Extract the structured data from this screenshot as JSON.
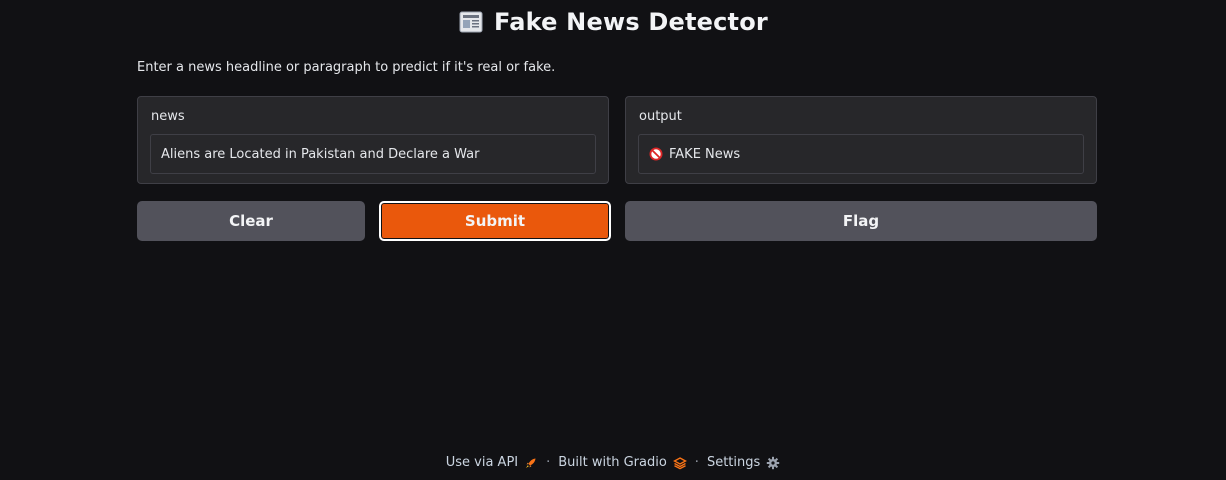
{
  "app": {
    "title": "Fake News Detector",
    "title_icon": "newspaper-icon",
    "description": "Enter a news headline or paragraph to predict if it's real or fake."
  },
  "input_panel": {
    "label": "news",
    "value": "Aliens are Located in Pakistan and Declare a War"
  },
  "output_panel": {
    "label": "output",
    "value": "FAKE News",
    "icon": "prohibited-icon"
  },
  "buttons": {
    "clear": "Clear",
    "submit": "Submit",
    "flag": "Flag"
  },
  "footer": {
    "api": "Use via API",
    "api_icon": "rocket-icon",
    "separator": "·",
    "built": "Built with Gradio",
    "built_icon": "gradio-logo-icon",
    "settings": "Settings",
    "settings_icon": "gear-icon"
  },
  "colors": {
    "background": "#111114",
    "panel": "#27272a",
    "button_secondary": "#52525b",
    "button_primary": "#ea580c"
  }
}
